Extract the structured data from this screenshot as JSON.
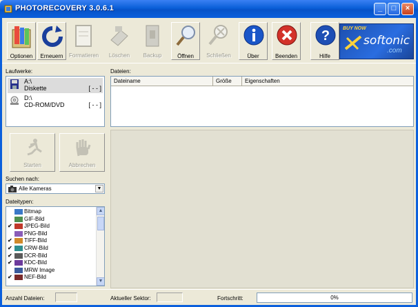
{
  "window": {
    "title": "PHOTORECOVERY 3.0.6.1"
  },
  "toolbar": {
    "buttons": [
      {
        "label": "Optionen",
        "icon": "options-icon",
        "enabled": true
      },
      {
        "label": "Erneuern",
        "icon": "refresh-icon",
        "enabled": true
      },
      {
        "label": "Formatieren",
        "icon": "format-icon",
        "enabled": false
      },
      {
        "label": "Löschen",
        "icon": "erase-icon",
        "enabled": false
      },
      {
        "label": "Backup",
        "icon": "backup-icon",
        "enabled": false
      },
      {
        "label": "Öffnen",
        "icon": "open-icon",
        "enabled": true
      },
      {
        "label": "Schließen",
        "icon": "close-icon",
        "enabled": false
      },
      {
        "label": "Über",
        "icon": "info-icon",
        "enabled": true
      },
      {
        "label": "Beenden",
        "icon": "exit-icon",
        "enabled": true
      },
      {
        "label": "Hilfe",
        "icon": "help-icon",
        "enabled": true
      }
    ]
  },
  "banner": {
    "buy": "BUY NOW",
    "name": "softonic",
    "tld": ".com"
  },
  "drives": {
    "label": "Laufwerke:",
    "items": [
      {
        "letter": "A:\\",
        "name": "Diskette",
        "status": "[ - - ]",
        "icon": "floppy-icon"
      },
      {
        "letter": "D:\\",
        "name": "CD-ROM/DVD",
        "status": "[ - - ]",
        "icon": "cdrom-icon"
      }
    ]
  },
  "files": {
    "label": "Dateien:",
    "columns": [
      "Dateiname",
      "Größe",
      "Eigenschaften"
    ]
  },
  "actions": {
    "start": "Starten",
    "abort": "Abbrechen"
  },
  "search": {
    "label": "Suchen nach:",
    "selected": "Alle Kameras"
  },
  "filetypes": {
    "label": "Dateitypen:",
    "items": [
      {
        "name": "Bitmap",
        "checked": false
      },
      {
        "name": "GIF-Bild",
        "checked": false
      },
      {
        "name": "JPEG-Bild",
        "checked": true
      },
      {
        "name": "PNG-Bild",
        "checked": false
      },
      {
        "name": "TIFF-Bild",
        "checked": true
      },
      {
        "name": "CRW-Bild",
        "checked": true
      },
      {
        "name": "DCR-Bild",
        "checked": true
      },
      {
        "name": "KDC-Bild",
        "checked": true
      },
      {
        "name": "MRW Image",
        "checked": false
      },
      {
        "name": "NEF-Bild",
        "checked": true
      }
    ]
  },
  "status": {
    "files_label": "Anzahl Dateien:",
    "sector_label": "Aktueller Sektor:",
    "progress_label": "Fortschritt:",
    "progress_text": "0%",
    "progress": 0
  }
}
